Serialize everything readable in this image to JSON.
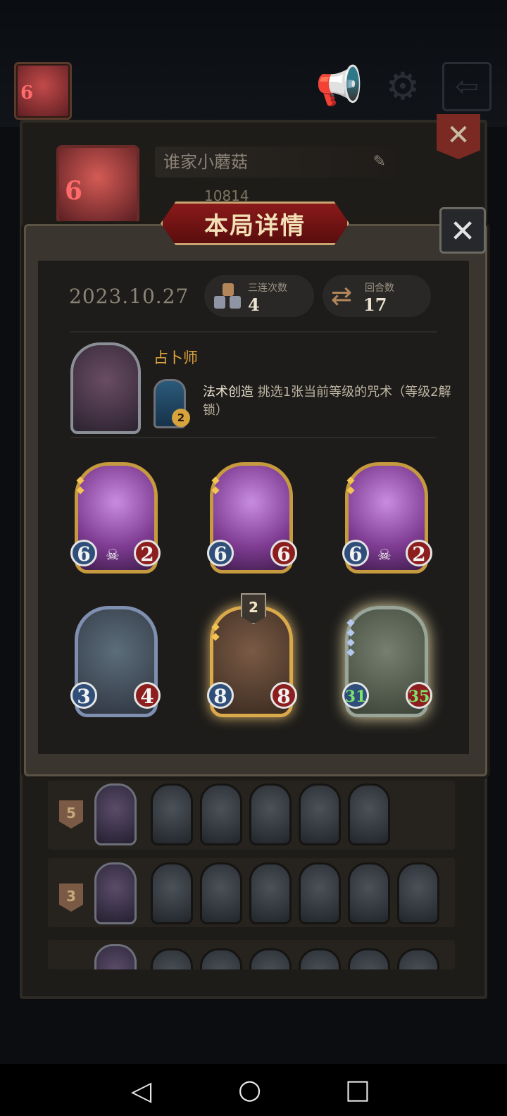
{
  "top": {
    "player_level": "6",
    "icons": [
      "megaphone-icon",
      "gear-icon",
      "exit-icon"
    ]
  },
  "profile": {
    "level": "6",
    "name": "谁家小蘑菇",
    "score": "10814"
  },
  "modal": {
    "title": "本局详情",
    "date": "2023.10.27",
    "triples_label": "三连次数",
    "triples_value": "4",
    "rounds_label": "回合数",
    "rounds_value": "17",
    "hero_name": "占卜师",
    "ability_level": "2",
    "ability_name": "法术创造",
    "ability_desc": "挑选1张当前等级的咒术（等级2解锁）"
  },
  "cards": [
    {
      "name": "bunny-toy",
      "atk": "6",
      "hp": "2",
      "style": "purple"
    },
    {
      "name": "airship",
      "atk": "6",
      "hp": "6",
      "style": "purple"
    },
    {
      "name": "bunny-toy",
      "atk": "6",
      "hp": "2",
      "style": "purple"
    },
    {
      "name": "dragon",
      "atk": "3",
      "hp": "4",
      "style": "blue"
    },
    {
      "name": "clown",
      "atk": "8",
      "hp": "8",
      "style": "clown",
      "tier": "2"
    },
    {
      "name": "robot",
      "atk": "31",
      "hp": "35",
      "style": "robot"
    }
  ],
  "history": [
    {
      "rank": "5"
    },
    {
      "rank": "3"
    }
  ],
  "colors": {
    "accent_gold": "#e0a53e",
    "banner_red": "#8a1a1a"
  }
}
